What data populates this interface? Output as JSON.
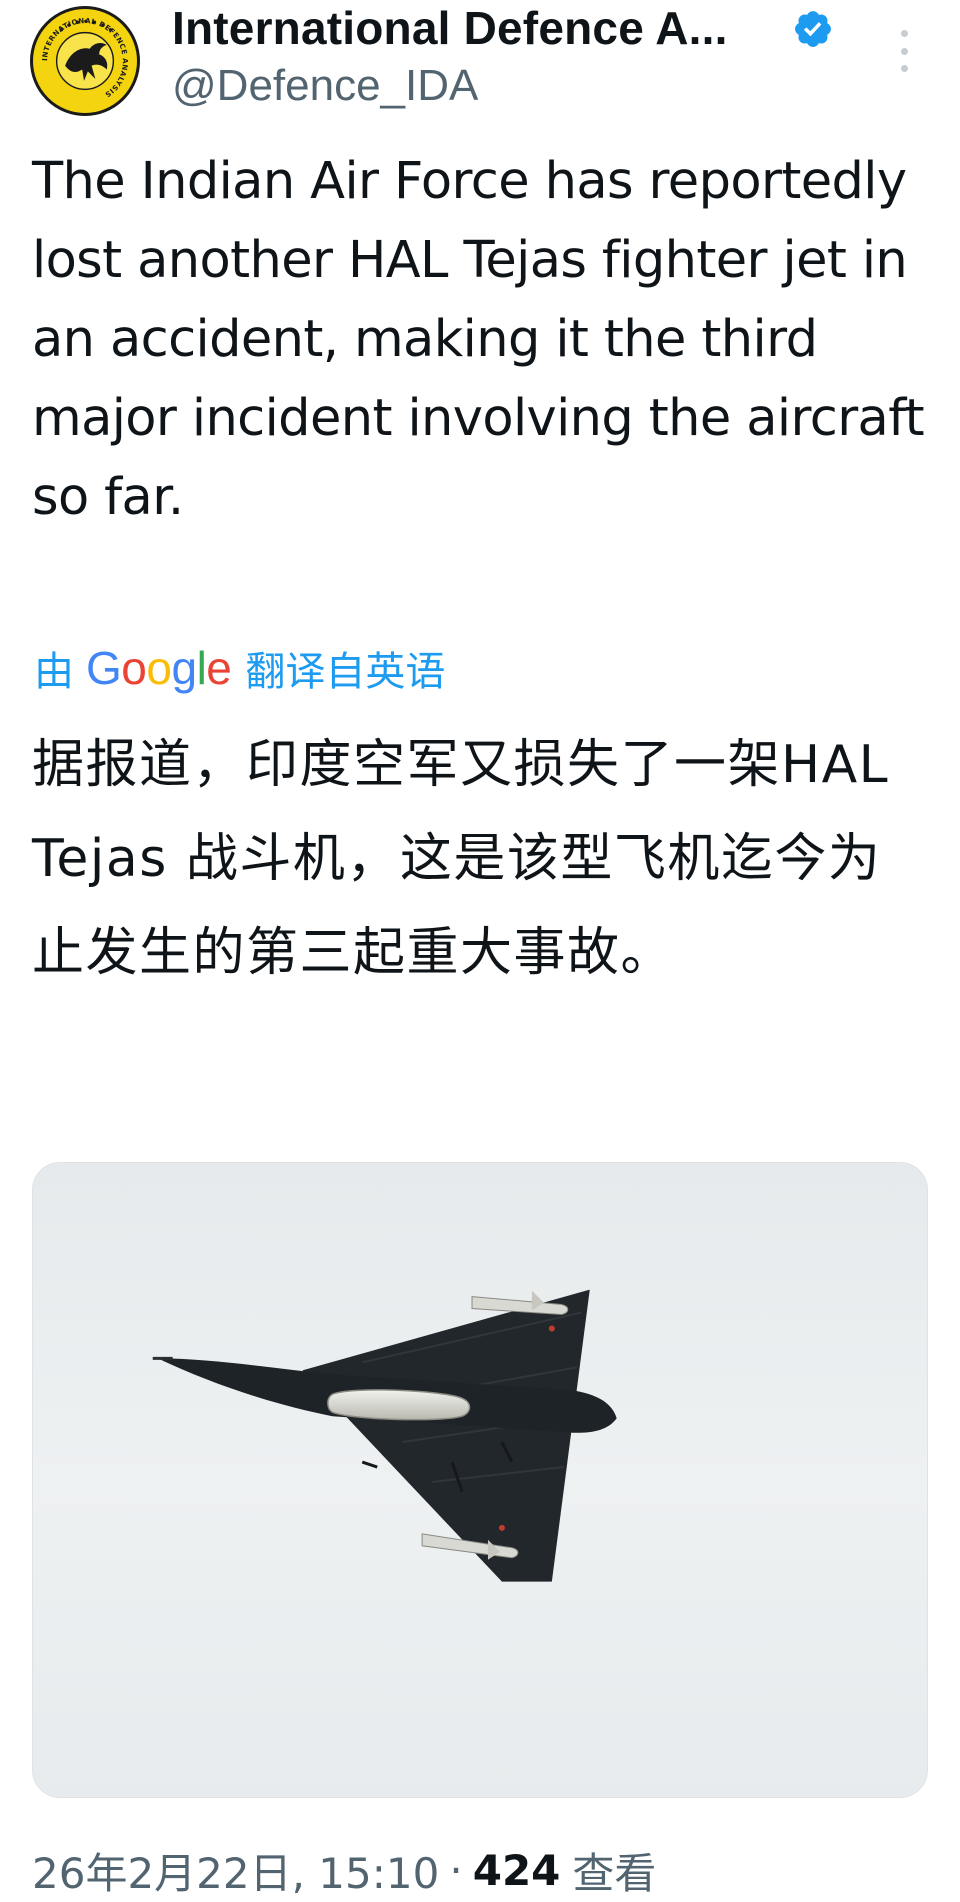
{
  "author": {
    "display_name": "International Defence A...",
    "handle": "@Defence_IDA",
    "avatar_text": "INTERNATIONAL DEFENCE ANALYSIS",
    "verified": true
  },
  "tweet": {
    "text": "The Indian Air Force has reportedly lost another HAL Tejas fighter jet in an accident, making it the third major incident involving the aircraft so far."
  },
  "translation": {
    "by_label": "由",
    "provider": "Google",
    "from_label": "翻译自英语",
    "text": "据报道，印度空军又损失了一架HAL Tejas 战斗机，这是该型飞机迄今为止发生的第三起重大事故。"
  },
  "meta": {
    "timestamp": "26年2月22日, 15:10",
    "separator": "·",
    "views_count": "424",
    "views_label": "查看"
  },
  "colors": {
    "accent": "#1d9bf0",
    "secondary_text": "#536471",
    "primary_text": "#0f1419"
  },
  "icons": {
    "verified": "verified-badge-icon",
    "more": "more-options-icon"
  }
}
